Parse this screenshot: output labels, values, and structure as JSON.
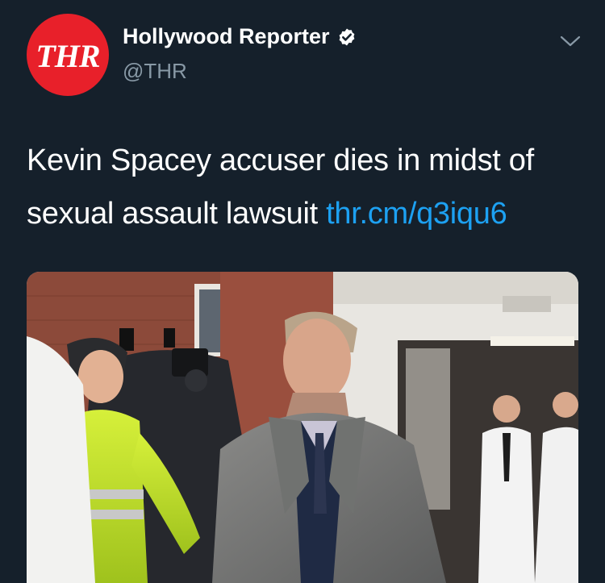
{
  "account": {
    "avatar_text": "THR",
    "display_name": "Hollywood Reporter",
    "handle": "@THR",
    "verified": true
  },
  "tweet": {
    "text": "Kevin Spacey accuser dies in midst of sexual assault lawsuit ",
    "link": "thr.cm/q3iqu6"
  },
  "icons": {
    "verified": "verified-badge-icon",
    "menu": "chevron-down-icon"
  },
  "colors": {
    "background": "#15202b",
    "brand": "#e8202a",
    "link": "#1da1f2",
    "secondary_text": "#8899a6"
  }
}
